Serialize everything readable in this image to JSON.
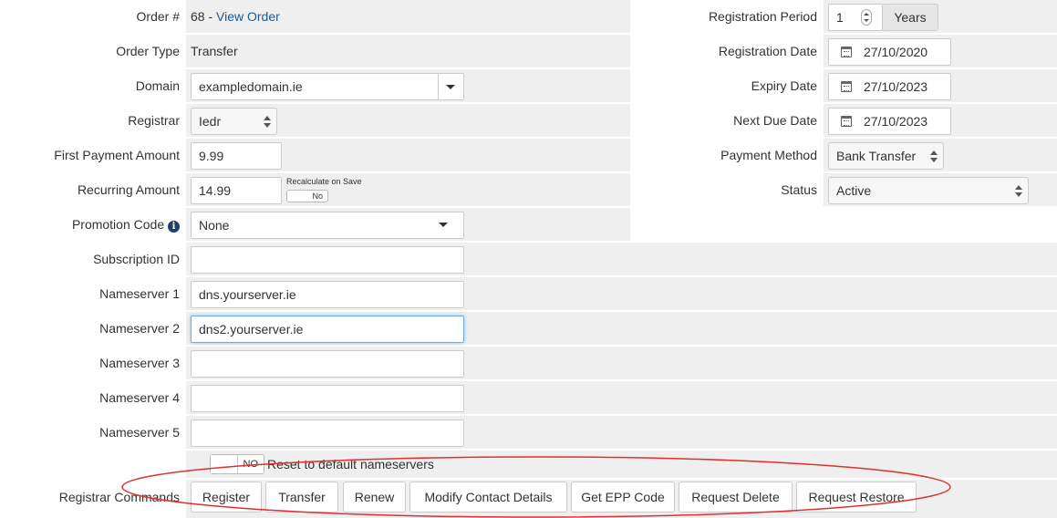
{
  "left": {
    "order_label": "Order #",
    "order_number": "68 - ",
    "view_order": "View Order",
    "order_type_label": "Order Type",
    "order_type": "Transfer",
    "domain_label": "Domain",
    "domain": "exampledomain.ie",
    "registrar_label": "Registrar",
    "registrar": "Iedr",
    "first_payment_label": "First Payment Amount",
    "first_payment": "9.99",
    "recurring_label": "Recurring Amount",
    "recurring": "14.99",
    "recalc_label": "Recalculate on Save",
    "recalc_toggle": "No",
    "promo_label": "Promotion Code",
    "promo_info": "i",
    "promo": "None",
    "subscription_label": "Subscription ID",
    "subscription": "",
    "ns1_label": "Nameserver 1",
    "ns1": "dns.yourserver.ie",
    "ns2_label": "Nameserver 2",
    "ns2": "dns2.yourserver.ie",
    "ns3_label": "Nameserver 3",
    "ns3": "",
    "ns4_label": "Nameserver 4",
    "ns4": "",
    "ns5_label": "Nameserver 5",
    "ns5": "",
    "reset_toggle": "NO",
    "reset_label": "Reset to default nameservers",
    "commands_label": "Registrar Commands"
  },
  "right": {
    "reg_period_label": "Registration Period",
    "reg_period": "1",
    "reg_period_unit": "Years",
    "reg_date_label": "Registration Date",
    "reg_date": "27/10/2020",
    "expiry_label": "Expiry Date",
    "expiry": "27/10/2023",
    "next_due_label": "Next Due Date",
    "next_due": "27/10/2023",
    "payment_method_label": "Payment Method",
    "payment_method": "Bank Transfer",
    "status_label": "Status",
    "status": "Active"
  },
  "commands": [
    "Register",
    "Transfer",
    "Renew",
    "Modify Contact Details",
    "Get EPP Code",
    "Request Delete",
    "Request Restore"
  ],
  "colors": {
    "annotation": "#e03030",
    "link": "#1a5a96",
    "cell_bg": "#efefef"
  }
}
